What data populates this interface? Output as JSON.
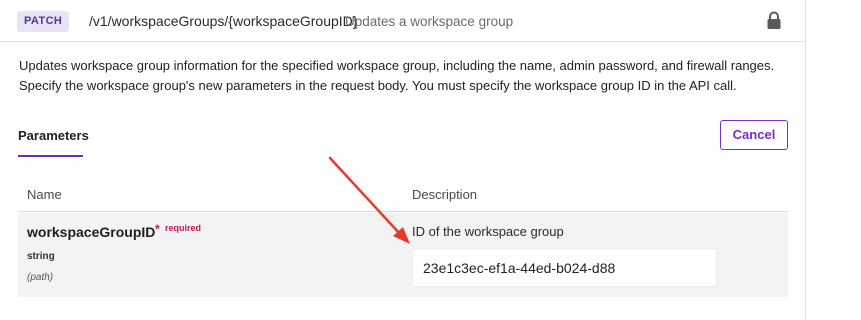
{
  "header": {
    "method": "PATCH",
    "path": "/v1/workspaceGroups/{workspaceGroupID}",
    "summary": "Updates a workspace group",
    "lock_icon": "lock-icon"
  },
  "description": "Updates workspace group information for the specified workspace group, including the name, admin password, and firewall ranges. Specify the workspace group's new parameters in the request body. You must specify the workspace group ID in the API call.",
  "tabs": {
    "parameters_label": "Parameters",
    "cancel_label": "Cancel"
  },
  "table": {
    "columns": [
      "Name",
      "Description"
    ],
    "rows": [
      {
        "name": "workspaceGroupID",
        "required_star": "*",
        "required_label": "required",
        "type": "string",
        "in": "(path)",
        "description": "ID of the workspace group",
        "value": "23e1c3ec-ef1a-44ed-b024-d88"
      }
    ]
  },
  "colors": {
    "accent": "#7a2ec0",
    "required": "#c2185b",
    "annotation_arrow": "#e8392b"
  }
}
